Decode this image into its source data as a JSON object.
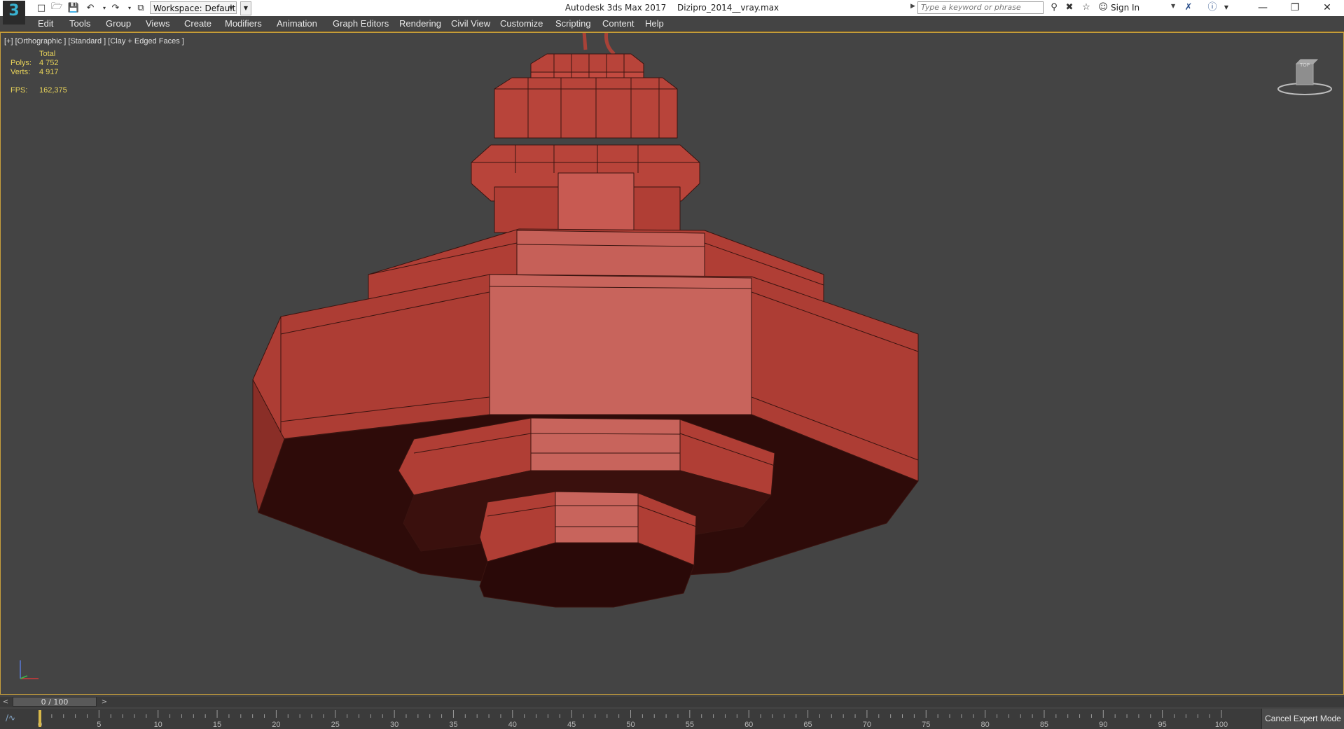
{
  "titlebar": {
    "app_name": "Autodesk 3ds Max 2017",
    "file_name": "Dizipro_2014__vray.max",
    "workspace": "Workspace: Default",
    "search_placeholder": "Type a keyword or phrase",
    "sign_in": "Sign In"
  },
  "menu": {
    "items": [
      "Edit",
      "Tools",
      "Group",
      "Views",
      "Create",
      "Modifiers",
      "Animation",
      "Graph Editors",
      "Rendering",
      "Civil View",
      "Customize",
      "Scripting",
      "Content",
      "Help"
    ]
  },
  "viewport": {
    "label": "[+] [Orthographic ] [Standard ] [Clay + Edged Faces ]",
    "stats": {
      "total_label": "Total",
      "polys_label": "Polys:",
      "polys_value": "4 752",
      "verts_label": "Verts:",
      "verts_value": "4 917",
      "fps_label": "FPS:",
      "fps_value": "162,375"
    },
    "model_color": "#c0483e",
    "viewcube_label": "TOP"
  },
  "timeline": {
    "frame_display": "0 / 100",
    "current_frame": 0,
    "start": 0,
    "end": 100,
    "ticks": [
      "0",
      "5",
      "10",
      "15",
      "20",
      "25",
      "30",
      "35",
      "40",
      "45",
      "50",
      "55",
      "60",
      "65",
      "70",
      "75",
      "80",
      "85",
      "90",
      "95",
      "100"
    ],
    "cancel_expert": "Cancel Expert Mode"
  },
  "icons": [
    "app-logo",
    "new-file-icon",
    "open-file-icon",
    "save-icon",
    "undo-icon",
    "redo-icon",
    "project-icon",
    "binoculars-icon",
    "tools-icon",
    "star-icon",
    "user-icon",
    "exchange-icon",
    "help-icon",
    "minimize-icon",
    "restore-icon",
    "close-icon",
    "curve-editor-icon"
  ]
}
